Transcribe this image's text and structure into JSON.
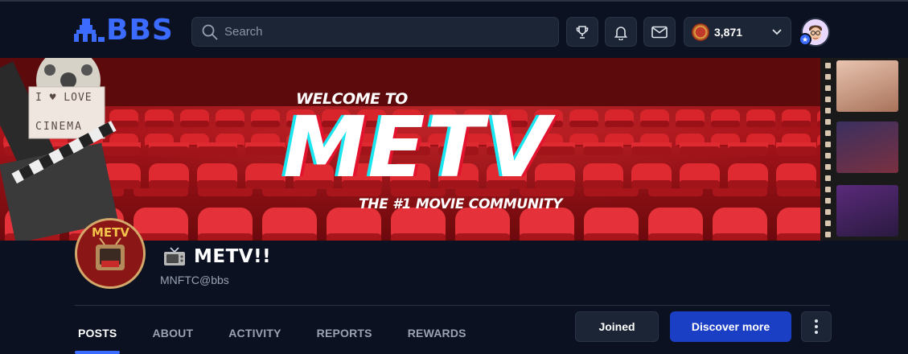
{
  "header": {
    "logo_text": "BBS",
    "search_placeholder": "Search",
    "icons": [
      "trophy-icon",
      "bell-icon",
      "mail-icon"
    ],
    "points_value": "3,871",
    "accent_color": "#3b6bff"
  },
  "banner": {
    "welcome_text": "WELCOME TO",
    "title_text": "METV",
    "tagline_text": "THE #1 MOVIE COMMUNITY",
    "sign_text": [
      "I ♥ LOVE",
      "CINEMA"
    ]
  },
  "community": {
    "avatar_text": "METV",
    "name": "METV!!",
    "handle": "MNFTC@bbs"
  },
  "tabs": [
    {
      "label": "POSTS",
      "active": true
    },
    {
      "label": "ABOUT",
      "active": false
    },
    {
      "label": "ACTIVITY",
      "active": false
    },
    {
      "label": "REPORTS",
      "active": false
    },
    {
      "label": "REWARDS",
      "active": false
    }
  ],
  "actions": {
    "joined_label": "Joined",
    "discover_label": "Discover more"
  }
}
